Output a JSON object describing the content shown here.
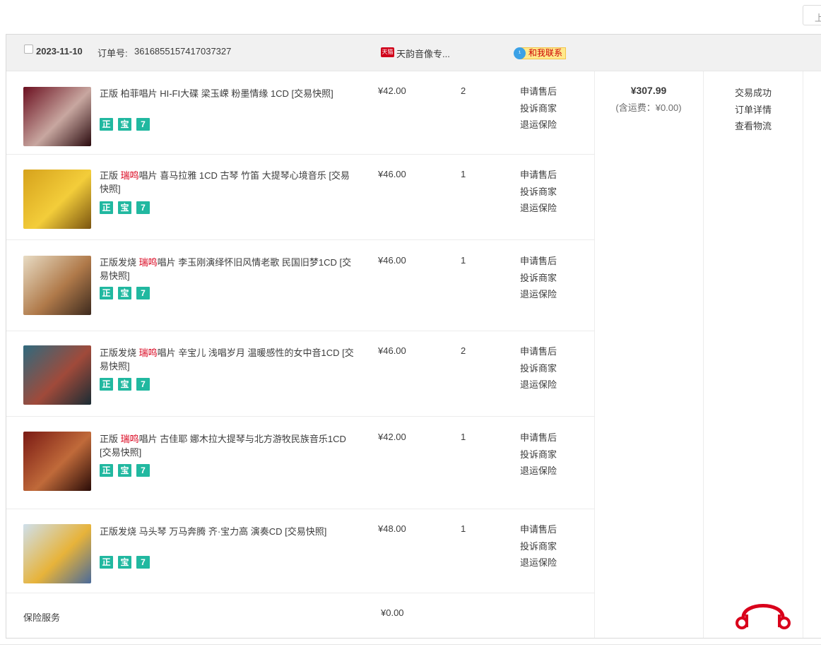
{
  "top_button": "上",
  "order": {
    "date": "2023-11-10",
    "order_no_label": "订单号:",
    "order_no": "3616855157417037327",
    "shop_badge": "天猫",
    "shop_name": "天韵音像专...",
    "contact_label": "和我联系"
  },
  "items": [
    {
      "title_pre": "正版 柏菲唱片 HI-FI大碟 梁玉嵘 粉墨情缘 1CD [交易快照]",
      "title_red": "",
      "title_post": "",
      "price": "¥42.00",
      "qty": "2",
      "ops": [
        "申请售后",
        "投诉商家",
        "退运保险"
      ],
      "badges": [
        "正",
        "宝",
        "7"
      ],
      "cover_colors": [
        "#6b1020",
        "#c8a7a0",
        "#2a0a0e"
      ]
    },
    {
      "title_pre": "正版 ",
      "title_red": "瑞鸣",
      "title_post": "唱片 喜马拉雅 1CD 古琴 竹笛 大提琴心境音乐 [交易快照]",
      "price": "¥46.00",
      "qty": "1",
      "ops": [
        "申请售后",
        "投诉商家",
        "退运保险"
      ],
      "badges": [
        "正",
        "宝",
        "7"
      ],
      "cover_colors": [
        "#d6a21c",
        "#f3cd3a",
        "#7a5410"
      ]
    },
    {
      "title_pre": "正版发烧 ",
      "title_red": "瑞鸣",
      "title_post": "唱片 李玉刚演绎怀旧风情老歌 民国旧梦1CD [交易快照]",
      "price": "¥46.00",
      "qty": "1",
      "ops": [
        "申请售后",
        "投诉商家",
        "退运保险"
      ],
      "badges": [
        "正",
        "宝",
        "7"
      ],
      "cover_colors": [
        "#e8dcc4",
        "#b07a4a",
        "#3d2a1e"
      ]
    },
    {
      "title_pre": "正版发烧 ",
      "title_red": "瑞鸣",
      "title_post": "唱片 辛宝儿 浅唱岁月 温暖感性的女中音1CD [交易快照]",
      "price": "¥46.00",
      "qty": "2",
      "ops": [
        "申请售后",
        "投诉商家",
        "退运保险"
      ],
      "badges": [
        "正",
        "宝",
        "7"
      ],
      "cover_colors": [
        "#2f6a7e",
        "#a04a3a",
        "#1a2c34"
      ]
    },
    {
      "title_pre": "正版 ",
      "title_red": "瑞鸣",
      "title_post": "唱片 古佳耶 娜木拉大提琴与北方游牧民族音乐1CD [交易快照]",
      "price": "¥42.00",
      "qty": "1",
      "ops": [
        "申请售后",
        "投诉商家",
        "退运保险"
      ],
      "badges": [
        "正",
        "宝",
        "7"
      ],
      "cover_colors": [
        "#7a1a14",
        "#c06a3a",
        "#2a0c08"
      ]
    },
    {
      "title_pre": "正版发烧 马头琴 万马奔腾 齐·宝力高 演奏CD [交易快照]",
      "title_red": "",
      "title_post": "",
      "price": "¥48.00",
      "qty": "1",
      "ops": [
        "申请售后",
        "投诉商家",
        "退运保险"
      ],
      "badges": [
        "正",
        "宝",
        "7"
      ],
      "cover_colors": [
        "#cfe0ec",
        "#e7b33a",
        "#4a6a9a"
      ]
    }
  ],
  "total": {
    "amount": "¥307.99",
    "shipping": "(含运费：¥0.00)"
  },
  "status": [
    "交易成功",
    "订单详情",
    "查看物流"
  ],
  "insurance": {
    "label": "保险服务",
    "price": "¥0.00"
  },
  "colors": {
    "accent": "#d9001b",
    "badge": "#21b8a0",
    "header_bg": "#f1f1f1"
  }
}
